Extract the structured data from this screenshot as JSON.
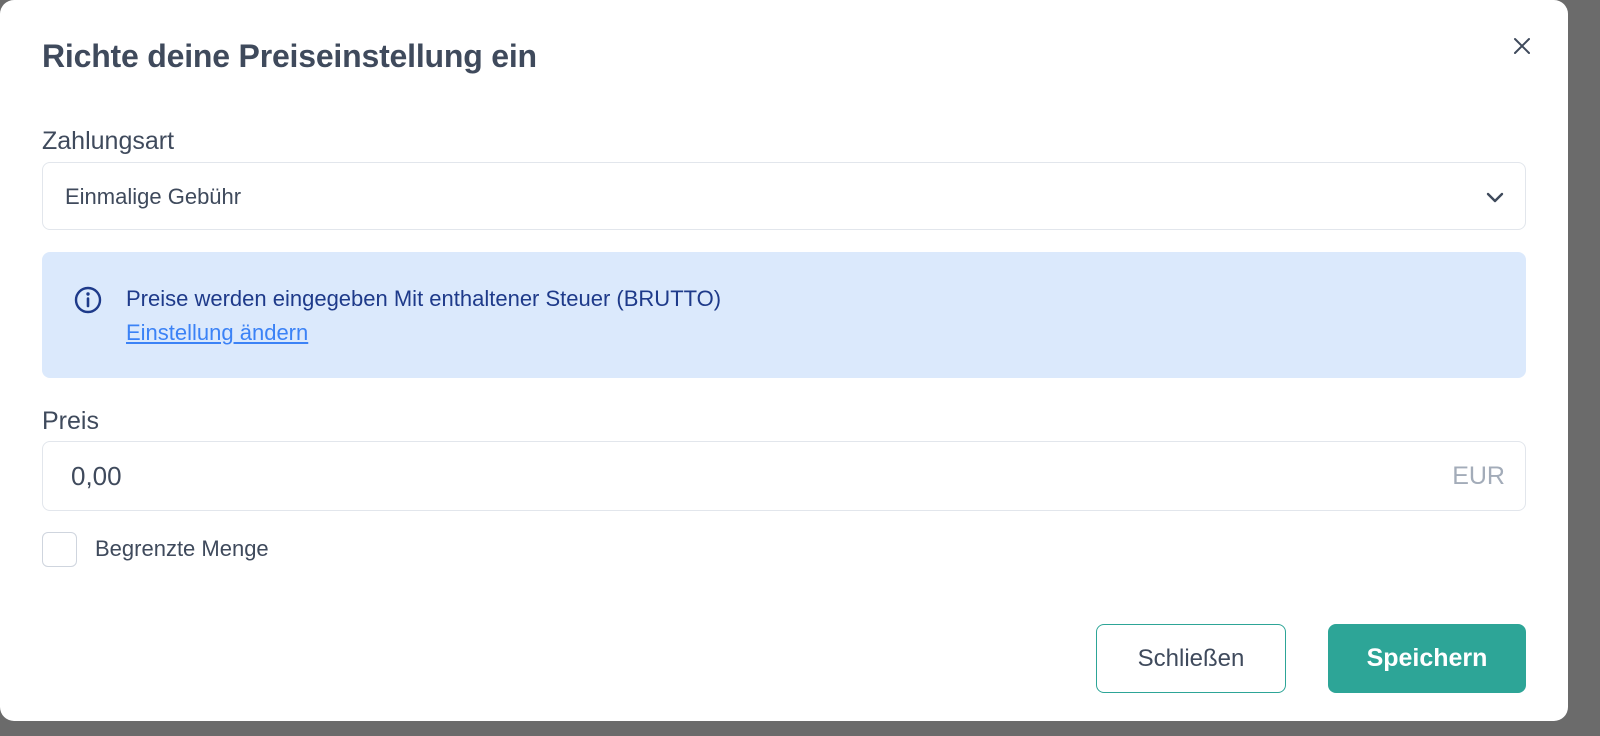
{
  "dialog": {
    "title": "Richte deine Preiseinstellung ein",
    "close_icon": "close-icon"
  },
  "payment_type": {
    "label": "Zahlungsart",
    "selected": "Einmalige Gebühr",
    "icon": "chevron-down-icon"
  },
  "info": {
    "icon": "info-circle-icon",
    "text": "Preise werden eingegeben Mit enthaltener Steuer (BRUTTO)",
    "link": "Einstellung ändern",
    "colors": {
      "background": "#dbe9fc",
      "text": "#1e3a8a",
      "link": "#3b82f6"
    }
  },
  "price": {
    "label": "Preis",
    "value": "0,00",
    "currency": "EUR"
  },
  "limited_quantity": {
    "label": "Begrenzte Menge",
    "checked": false
  },
  "footer": {
    "close_label": "Schließen",
    "save_label": "Speichern"
  },
  "colors": {
    "accent": "#2da597",
    "text": "#3f4a5c"
  }
}
